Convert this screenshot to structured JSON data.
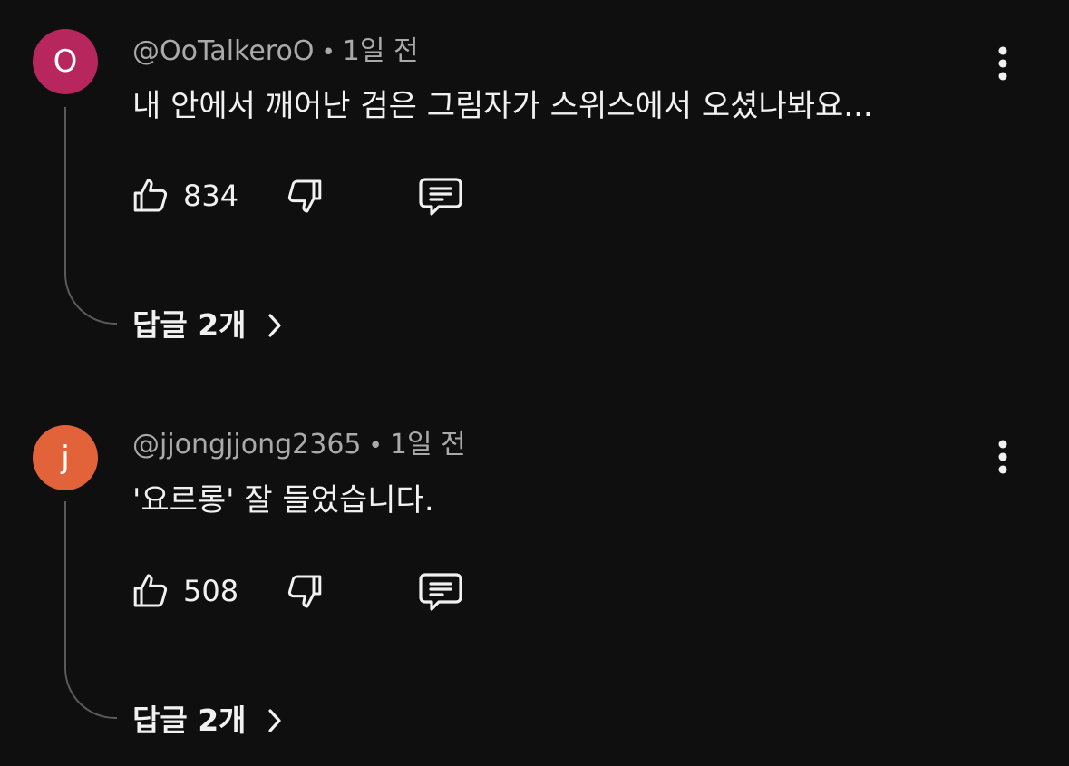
{
  "comments": [
    {
      "avatar_letter": "O",
      "avatar_color": "#b8265e",
      "author": "@OoTalkeroO",
      "separator": "•",
      "time": "1일 전",
      "text": "내 안에서 깨어난 검은 그림자가 스위스에서 오셨나봐요...",
      "likes": "834",
      "replies_label": "답글 2개"
    },
    {
      "avatar_letter": "j",
      "avatar_color": "#e2633a",
      "author": "@jjongjjong2365",
      "separator": "•",
      "time": "1일 전",
      "text": "'요르롱' 잘 들었습니다.",
      "likes": "508",
      "replies_label": "답글 2개"
    }
  ],
  "icons": {
    "like": "thumb-up-icon",
    "dislike": "thumb-down-icon",
    "reply": "comment-icon",
    "more": "more-vertical-icon",
    "chevron": "chevron-right-icon"
  },
  "colors": {
    "background": "#0f0f0f",
    "text": "#f1f1f1",
    "meta": "#aaaaaa",
    "thread_line": "#5a5a5a"
  }
}
